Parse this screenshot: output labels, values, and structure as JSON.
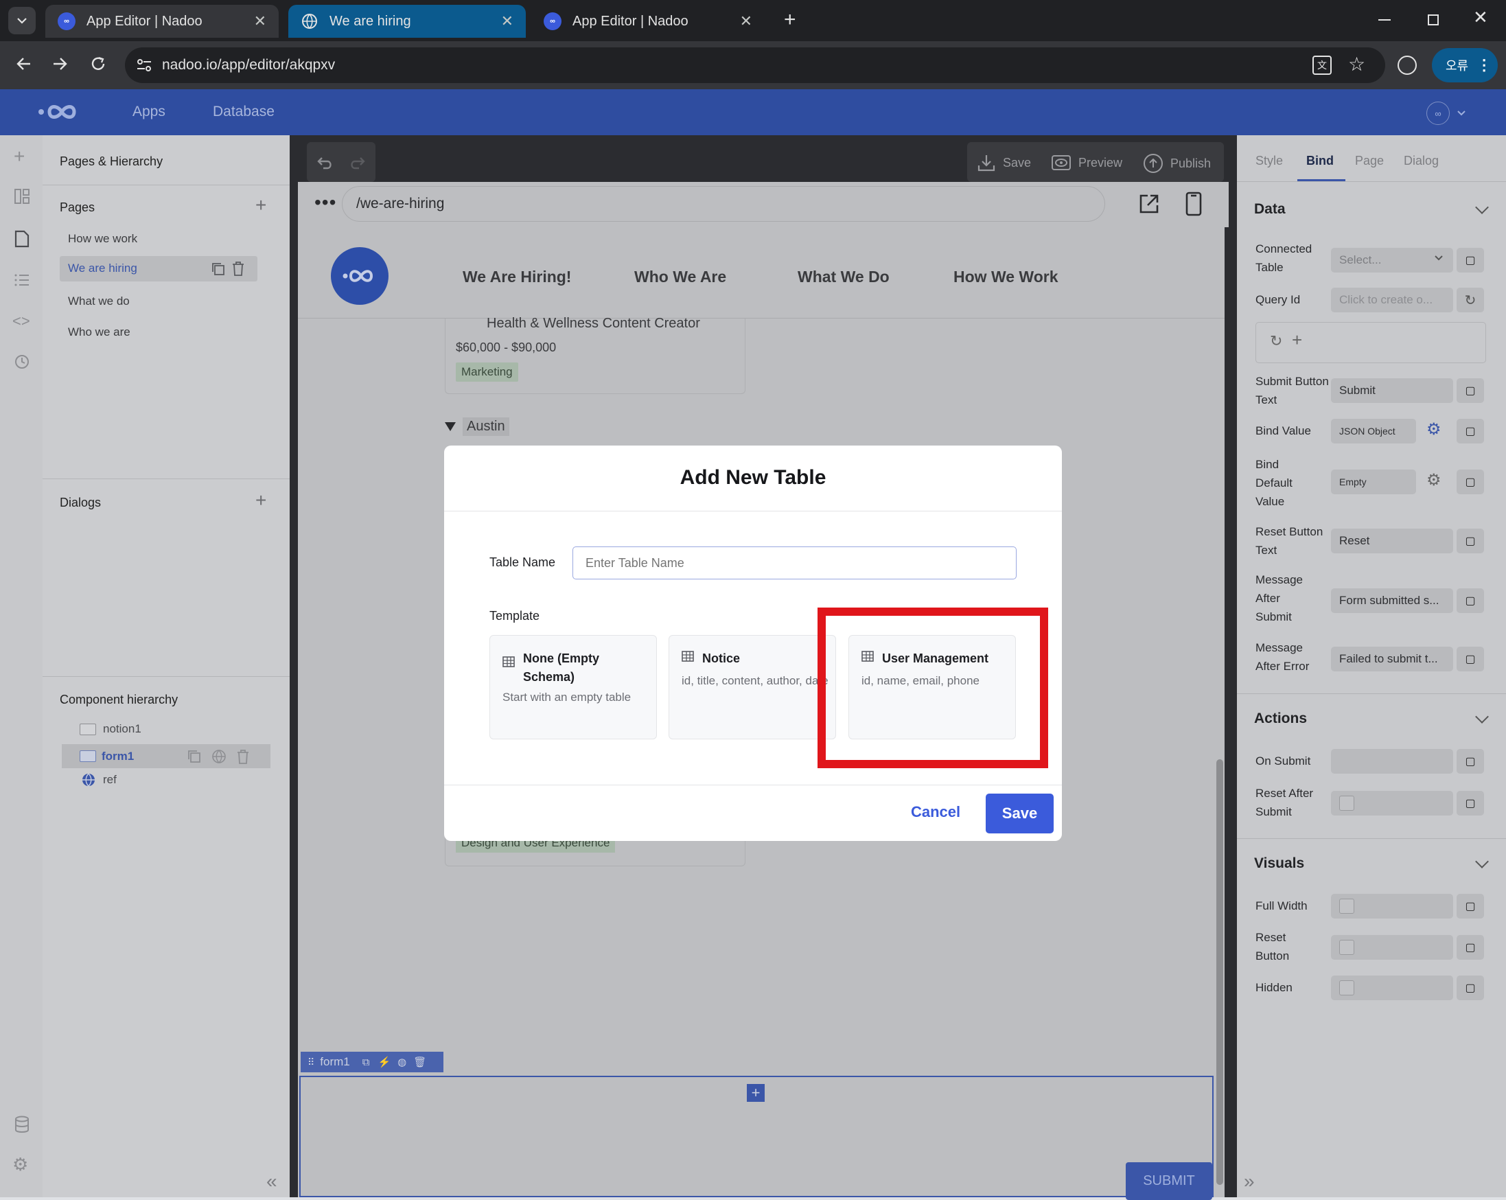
{
  "browser": {
    "tabs": [
      {
        "title": "App Editor | Nadoo"
      },
      {
        "title": "We are hiring"
      },
      {
        "title": "App Editor | Nadoo"
      }
    ],
    "url": "nadoo.io/app/editor/akqpxv",
    "profile_label": "오류"
  },
  "app": {
    "nav": {
      "apps": "Apps",
      "database": "Database"
    }
  },
  "left_panel": {
    "title": "Pages & Hierarchy",
    "pages_title": "Pages",
    "pages": [
      "How we work",
      "We are hiring",
      "What we do",
      "Who we are"
    ],
    "dialogs_title": "Dialogs",
    "hierarchy_title": "Component hierarchy",
    "components": [
      "notion1",
      "form1",
      "ref"
    ]
  },
  "editor": {
    "save": "Save",
    "preview": "Preview",
    "publish": "Publish",
    "route": "/we-are-hiring",
    "site_nav": [
      "We Are Hiring!",
      "Who We Are",
      "What We Do",
      "How We Work"
    ],
    "job_title": "Health & Wellness Content Creator",
    "salary": "$60,000 - $90,000",
    "job_tag": "Marketing",
    "location_group": "Austin",
    "bottom_tag": "Design and User Experience",
    "form_label": "form1",
    "submit": "SUBMIT"
  },
  "right_panel": {
    "tabs": [
      "Style",
      "Bind",
      "Page",
      "Dialog"
    ],
    "active_tab": "Bind",
    "data_section": "Data",
    "connected_table_label": "Connected Table",
    "connected_table_value": "Select...",
    "query_id_label": "Query Id",
    "query_id_value": "Click to create o...",
    "submit_button_text_label": "Submit Button Text",
    "submit_button_text_value": "Submit",
    "bind_value_label": "Bind Value",
    "bind_value_value": "JSON Object",
    "bind_default_label": "Bind Default Value",
    "bind_default_value": "Empty",
    "reset_button_text_label": "Reset Button Text",
    "reset_button_text_value": "Reset",
    "msg_after_submit_label": "Message After Submit",
    "msg_after_submit_value": "Form submitted s...",
    "msg_after_error_label": "Message After Error",
    "msg_after_error_value": "Failed to submit t...",
    "actions_section": "Actions",
    "on_submit_label": "On Submit",
    "reset_after_submit_label": "Reset After Submit",
    "visuals_section": "Visuals",
    "full_width_label": "Full Width",
    "reset_button_label": "Reset Button",
    "hidden_label": "Hidden"
  },
  "modal": {
    "title": "Add New Table",
    "table_name_label": "Table Name",
    "table_name_placeholder": "Enter Table Name",
    "template_label": "Template",
    "templates": [
      {
        "name": "None (Empty Schema)",
        "description": "Start with an empty table"
      },
      {
        "name": "Notice",
        "description": "id, title, content, author, date"
      },
      {
        "name": "User Management",
        "description": "id, name, email, phone"
      }
    ],
    "cancel": "Cancel",
    "save": "Save",
    "highlight_color": "#e0161b"
  }
}
